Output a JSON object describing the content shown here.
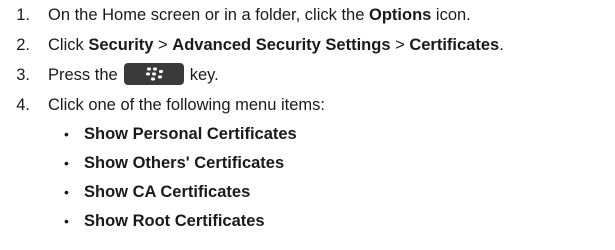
{
  "steps": [
    {
      "number": "1.",
      "pre": "On the Home screen or in a folder, click the ",
      "bold1": "Options",
      "post": " icon."
    },
    {
      "number": "2.",
      "pre": "Click ",
      "bold1": "Security",
      "sep1": " > ",
      "bold2": "Advanced Security Settings",
      "sep2": " > ",
      "bold3": "Certificates",
      "post": "."
    },
    {
      "number": "3.",
      "pre": "Press the",
      "key_icon": "blackberry-menu-key-icon",
      "post": "key."
    },
    {
      "number": "4.",
      "text": "Click one of the following menu items:"
    }
  ],
  "menu_items": [
    "Show Personal Certificates",
    "Show Others' Certificates",
    "Show CA Certificates",
    "Show Root Certificates"
  ],
  "bullet": "•",
  "colors": {
    "text": "#1a1a1a",
    "key_background": "#3a3a3a",
    "key_glyph": "#ffffff"
  }
}
